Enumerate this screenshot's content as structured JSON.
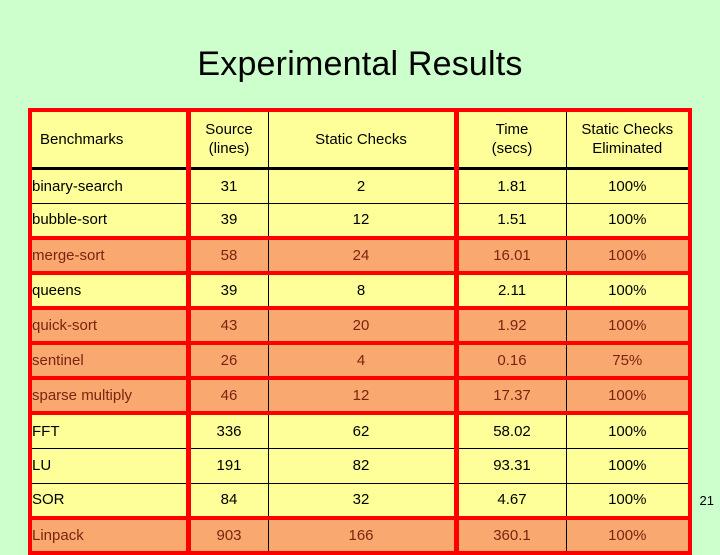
{
  "slide": {
    "title": "Experimental Results",
    "page_number": "21",
    "background_color": "#ccffcc",
    "table_border_color": "#ff0000",
    "row_color": "#ffff99",
    "highlight_row_color": "#f9a870",
    "highlight_text_color": "#7a2410"
  },
  "table": {
    "columns": [
      {
        "line1": "Benchmarks",
        "line2": ""
      },
      {
        "line1": "Source",
        "line2": "(lines)"
      },
      {
        "line1": "Static Checks",
        "line2": ""
      },
      {
        "line1": "Time",
        "line2": "(secs)"
      },
      {
        "line1": "Static Checks",
        "line2": "Eliminated"
      }
    ],
    "rows": [
      {
        "benchmark": "binary-search",
        "source_lines": "31",
        "static_checks": "2",
        "time_secs": "1.81",
        "checks_eliminated": "100%",
        "highlight": false
      },
      {
        "benchmark": "bubble-sort",
        "source_lines": "39",
        "static_checks": "12",
        "time_secs": "1.51",
        "checks_eliminated": "100%",
        "highlight": false
      },
      {
        "benchmark": "merge-sort",
        "source_lines": "58",
        "static_checks": "24",
        "time_secs": "16.01",
        "checks_eliminated": "100%",
        "highlight": true
      },
      {
        "benchmark": "queens",
        "source_lines": "39",
        "static_checks": "8",
        "time_secs": "2.11",
        "checks_eliminated": "100%",
        "highlight": false
      },
      {
        "benchmark": "quick-sort",
        "source_lines": "43",
        "static_checks": "20",
        "time_secs": "1.92",
        "checks_eliminated": "100%",
        "highlight": true
      },
      {
        "benchmark": "sentinel",
        "source_lines": "26",
        "static_checks": "4",
        "time_secs": "0.16",
        "checks_eliminated": "75%",
        "highlight": true
      },
      {
        "benchmark": "sparse multiply",
        "source_lines": "46",
        "static_checks": "12",
        "time_secs": "17.37",
        "checks_eliminated": "100%",
        "highlight": true
      },
      {
        "benchmark": "FFT",
        "source_lines": "336",
        "static_checks": "62",
        "time_secs": "58.02",
        "checks_eliminated": "100%",
        "highlight": false
      },
      {
        "benchmark": "LU",
        "source_lines": "191",
        "static_checks": "82",
        "time_secs": "93.31",
        "checks_eliminated": "100%",
        "highlight": false
      },
      {
        "benchmark": "SOR",
        "source_lines": "84",
        "static_checks": "32",
        "time_secs": "4.67",
        "checks_eliminated": "100%",
        "highlight": false
      },
      {
        "benchmark": "Linpack",
        "source_lines": "903",
        "static_checks": "166",
        "time_secs": "360.1",
        "checks_eliminated": "100%",
        "highlight": true
      }
    ]
  },
  "chart_data": {
    "type": "table",
    "title": "Experimental Results",
    "columns": [
      "Benchmarks",
      "Source (lines)",
      "Static Checks",
      "Time (secs)",
      "Static Checks Eliminated"
    ],
    "rows": [
      [
        "binary-search",
        31,
        2,
        1.81,
        "100%"
      ],
      [
        "bubble-sort",
        39,
        12,
        1.51,
        "100%"
      ],
      [
        "merge-sort",
        58,
        24,
        16.01,
        "100%"
      ],
      [
        "queens",
        39,
        8,
        2.11,
        "100%"
      ],
      [
        "quick-sort",
        43,
        20,
        1.92,
        "100%"
      ],
      [
        "sentinel",
        26,
        4,
        0.16,
        "75%"
      ],
      [
        "sparse multiply",
        46,
        12,
        17.37,
        "100%"
      ],
      [
        "FFT",
        336,
        62,
        58.02,
        "100%"
      ],
      [
        "LU",
        191,
        82,
        93.31,
        "100%"
      ],
      [
        "SOR",
        84,
        32,
        4.67,
        "100%"
      ],
      [
        "Linpack",
        903,
        166,
        360.1,
        "100%"
      ]
    ],
    "highlighted_rows": [
      "merge-sort",
      "quick-sort",
      "sentinel",
      "sparse multiply",
      "Linpack"
    ]
  }
}
